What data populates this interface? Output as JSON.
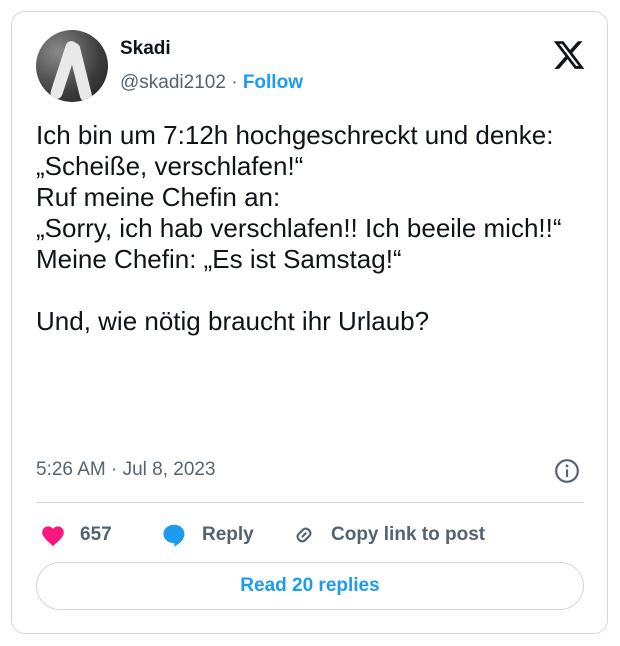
{
  "author": {
    "name": "Skadi",
    "handle": "@skadi2102",
    "separator": " · ",
    "follow_label": "Follow"
  },
  "tweet": {
    "lines": [
      "Ich bin um 7:12h hochgeschreckt und denke:",
      "„Scheiße, verschlafen!“",
      "Ruf meine Chefin an:",
      "„Sorry, ich hab verschlafen!! Ich beeile mich!!“",
      "Meine Chefin: „Es ist Samstag!“",
      "",
      "Und, wie nötig braucht ihr Urlaub?"
    ]
  },
  "meta": {
    "timestamp": "5:26 AM · Jul 8, 2023"
  },
  "actions": {
    "like_count": "657",
    "reply_label": "Reply",
    "copy_label": "Copy link to post"
  },
  "footer": {
    "read_replies_label": "Read 20 replies"
  },
  "colors": {
    "accent": "#1d9bf0",
    "like": "#f91880",
    "muted": "#536471",
    "text": "#0f1419",
    "border": "#cfd9de"
  },
  "icons": {
    "logo": "x-logo-icon",
    "like": "heart-icon",
    "reply": "speech-bubble-icon",
    "copy": "link-icon",
    "info": "info-icon"
  }
}
